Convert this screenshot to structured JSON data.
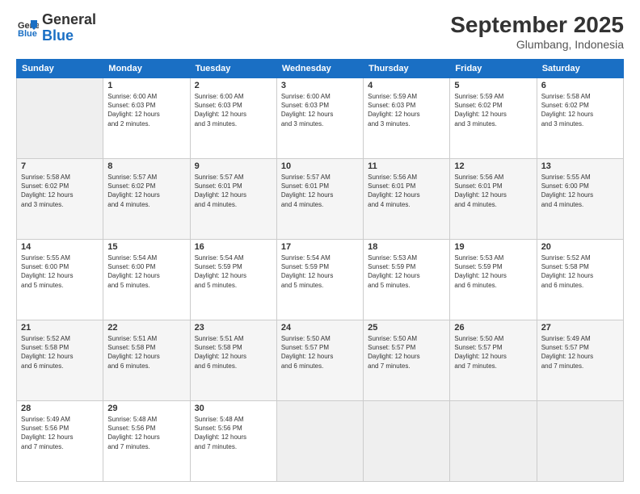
{
  "header": {
    "logo_line1": "General",
    "logo_line2": "Blue",
    "month_title": "September 2025",
    "location": "Glumbang, Indonesia"
  },
  "days_of_week": [
    "Sunday",
    "Monday",
    "Tuesday",
    "Wednesday",
    "Thursday",
    "Friday",
    "Saturday"
  ],
  "weeks": [
    [
      {
        "day": "",
        "info": ""
      },
      {
        "day": "1",
        "info": "Sunrise: 6:00 AM\nSunset: 6:03 PM\nDaylight: 12 hours\nand 2 minutes."
      },
      {
        "day": "2",
        "info": "Sunrise: 6:00 AM\nSunset: 6:03 PM\nDaylight: 12 hours\nand 3 minutes."
      },
      {
        "day": "3",
        "info": "Sunrise: 6:00 AM\nSunset: 6:03 PM\nDaylight: 12 hours\nand 3 minutes."
      },
      {
        "day": "4",
        "info": "Sunrise: 5:59 AM\nSunset: 6:03 PM\nDaylight: 12 hours\nand 3 minutes."
      },
      {
        "day": "5",
        "info": "Sunrise: 5:59 AM\nSunset: 6:02 PM\nDaylight: 12 hours\nand 3 minutes."
      },
      {
        "day": "6",
        "info": "Sunrise: 5:58 AM\nSunset: 6:02 PM\nDaylight: 12 hours\nand 3 minutes."
      }
    ],
    [
      {
        "day": "7",
        "info": "Sunrise: 5:58 AM\nSunset: 6:02 PM\nDaylight: 12 hours\nand 3 minutes."
      },
      {
        "day": "8",
        "info": "Sunrise: 5:57 AM\nSunset: 6:02 PM\nDaylight: 12 hours\nand 4 minutes."
      },
      {
        "day": "9",
        "info": "Sunrise: 5:57 AM\nSunset: 6:01 PM\nDaylight: 12 hours\nand 4 minutes."
      },
      {
        "day": "10",
        "info": "Sunrise: 5:57 AM\nSunset: 6:01 PM\nDaylight: 12 hours\nand 4 minutes."
      },
      {
        "day": "11",
        "info": "Sunrise: 5:56 AM\nSunset: 6:01 PM\nDaylight: 12 hours\nand 4 minutes."
      },
      {
        "day": "12",
        "info": "Sunrise: 5:56 AM\nSunset: 6:01 PM\nDaylight: 12 hours\nand 4 minutes."
      },
      {
        "day": "13",
        "info": "Sunrise: 5:55 AM\nSunset: 6:00 PM\nDaylight: 12 hours\nand 4 minutes."
      }
    ],
    [
      {
        "day": "14",
        "info": "Sunrise: 5:55 AM\nSunset: 6:00 PM\nDaylight: 12 hours\nand 5 minutes."
      },
      {
        "day": "15",
        "info": "Sunrise: 5:54 AM\nSunset: 6:00 PM\nDaylight: 12 hours\nand 5 minutes."
      },
      {
        "day": "16",
        "info": "Sunrise: 5:54 AM\nSunset: 5:59 PM\nDaylight: 12 hours\nand 5 minutes."
      },
      {
        "day": "17",
        "info": "Sunrise: 5:54 AM\nSunset: 5:59 PM\nDaylight: 12 hours\nand 5 minutes."
      },
      {
        "day": "18",
        "info": "Sunrise: 5:53 AM\nSunset: 5:59 PM\nDaylight: 12 hours\nand 5 minutes."
      },
      {
        "day": "19",
        "info": "Sunrise: 5:53 AM\nSunset: 5:59 PM\nDaylight: 12 hours\nand 6 minutes."
      },
      {
        "day": "20",
        "info": "Sunrise: 5:52 AM\nSunset: 5:58 PM\nDaylight: 12 hours\nand 6 minutes."
      }
    ],
    [
      {
        "day": "21",
        "info": "Sunrise: 5:52 AM\nSunset: 5:58 PM\nDaylight: 12 hours\nand 6 minutes."
      },
      {
        "day": "22",
        "info": "Sunrise: 5:51 AM\nSunset: 5:58 PM\nDaylight: 12 hours\nand 6 minutes."
      },
      {
        "day": "23",
        "info": "Sunrise: 5:51 AM\nSunset: 5:58 PM\nDaylight: 12 hours\nand 6 minutes."
      },
      {
        "day": "24",
        "info": "Sunrise: 5:50 AM\nSunset: 5:57 PM\nDaylight: 12 hours\nand 6 minutes."
      },
      {
        "day": "25",
        "info": "Sunrise: 5:50 AM\nSunset: 5:57 PM\nDaylight: 12 hours\nand 7 minutes."
      },
      {
        "day": "26",
        "info": "Sunrise: 5:50 AM\nSunset: 5:57 PM\nDaylight: 12 hours\nand 7 minutes."
      },
      {
        "day": "27",
        "info": "Sunrise: 5:49 AM\nSunset: 5:57 PM\nDaylight: 12 hours\nand 7 minutes."
      }
    ],
    [
      {
        "day": "28",
        "info": "Sunrise: 5:49 AM\nSunset: 5:56 PM\nDaylight: 12 hours\nand 7 minutes."
      },
      {
        "day": "29",
        "info": "Sunrise: 5:48 AM\nSunset: 5:56 PM\nDaylight: 12 hours\nand 7 minutes."
      },
      {
        "day": "30",
        "info": "Sunrise: 5:48 AM\nSunset: 5:56 PM\nDaylight: 12 hours\nand 7 minutes."
      },
      {
        "day": "",
        "info": ""
      },
      {
        "day": "",
        "info": ""
      },
      {
        "day": "",
        "info": ""
      },
      {
        "day": "",
        "info": ""
      }
    ]
  ]
}
